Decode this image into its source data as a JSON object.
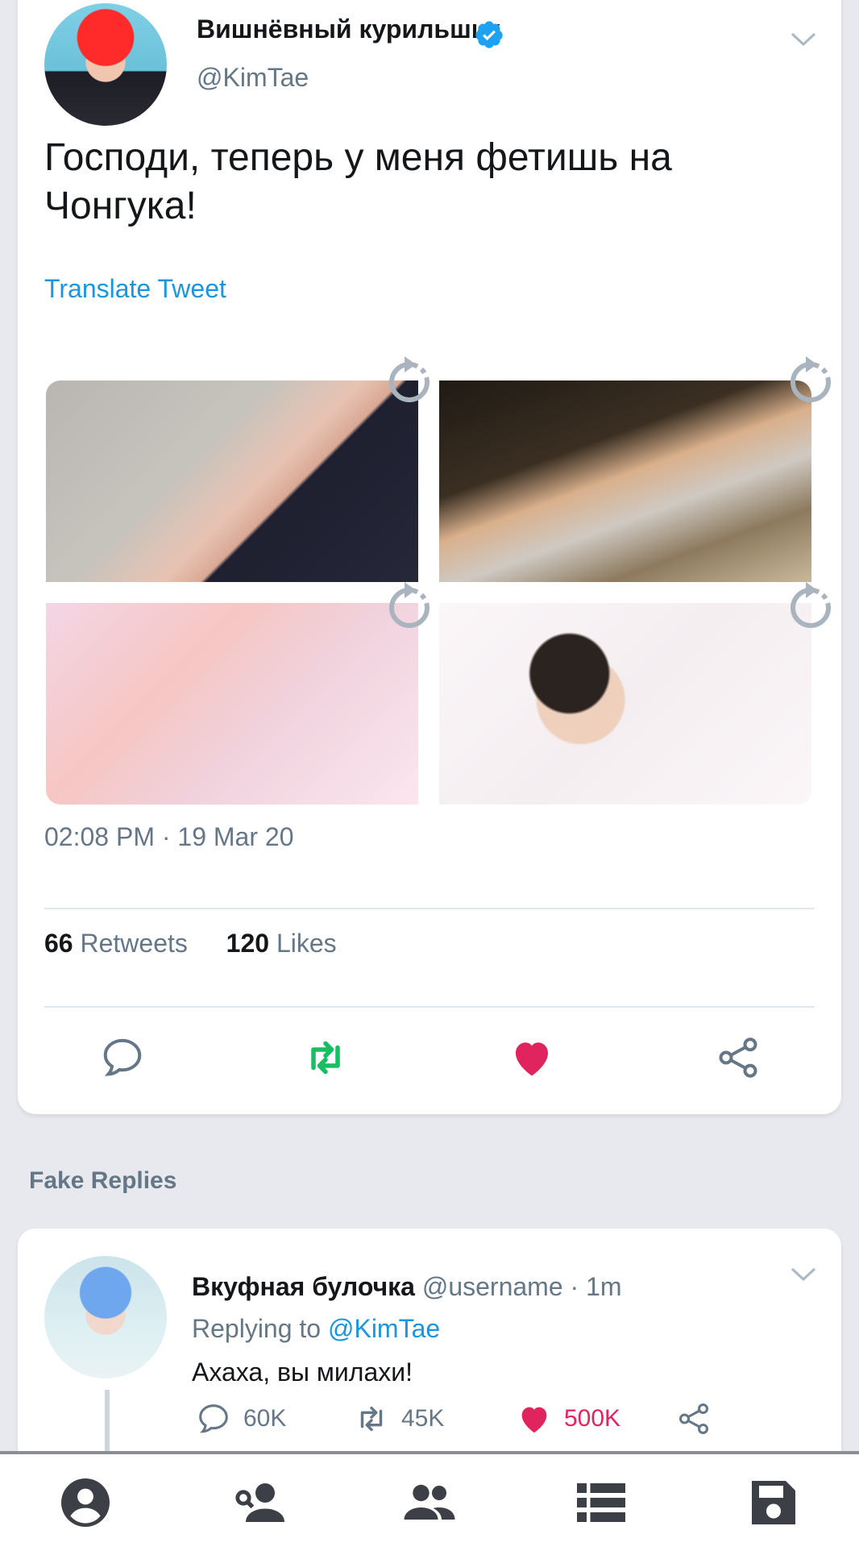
{
  "tweet": {
    "author_name": "Вишнёвный курильшик",
    "author_handle": "@KimTae",
    "text": "Господи, теперь у меня фетишь на\nЧонгука!",
    "translate_label": "Translate Tweet",
    "timestamp": "02:08 PM · 19 Mar 20",
    "retweets_count": "66",
    "retweets_label": "Retweets",
    "likes_count": "120",
    "likes_label": "Likes",
    "photos": [
      "photo-1",
      "photo-2",
      "photo-3",
      "photo-4"
    ]
  },
  "fake_replies_label": "Fake Replies",
  "reply": {
    "name": "Вкуфная булочка",
    "handle_time": "@username · 1m",
    "replying_prefix": "Replying to",
    "replying_mention": "@KimTae",
    "text": "Ахаха, вы милахи!",
    "comments": "60K",
    "retweets": "45K",
    "likes": "500K"
  },
  "colors": {
    "accent": "#1b95e0",
    "like": "#e0245e",
    "retweet": "#17bf63",
    "muted": "#657786"
  },
  "icons": {
    "verified": "verified-badge-icon",
    "chevron": "chevron-down-icon",
    "reply": "comment-icon",
    "retweet": "retweet-icon",
    "like": "heart-icon",
    "share": "share-icon",
    "nav": [
      "account-circle-icon",
      "user-search-icon",
      "group-icon",
      "list-icon",
      "save-icon"
    ]
  }
}
